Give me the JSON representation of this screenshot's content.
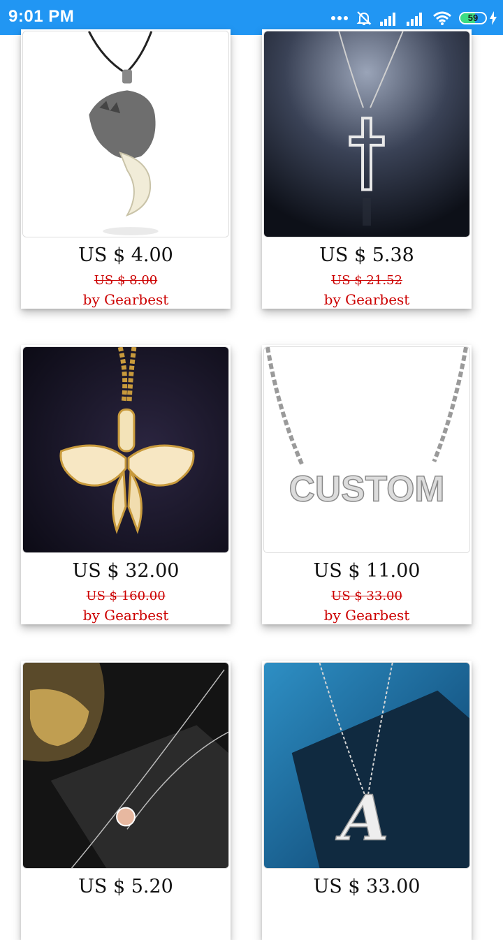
{
  "status_bar": {
    "time": "9:01 PM",
    "battery_level": "59"
  },
  "products": [
    {
      "name": "wolf-tooth-pendant",
      "price": "US $ 4.00",
      "old_price": "US $ 8.00",
      "seller": "by Gearbest"
    },
    {
      "name": "cross-pendant",
      "price": "US $ 5.38",
      "old_price": "US $ 21.52",
      "seller": "by Gearbest"
    },
    {
      "name": "butterfly-pendant",
      "price": "US $ 32.00",
      "old_price": "US $ 160.00",
      "seller": "by Gearbest"
    },
    {
      "name": "custom-name-necklace",
      "price": "US $ 11.00",
      "old_price": "US $ 33.00",
      "seller": "by Gearbest",
      "image_text": "CUSTOM"
    },
    {
      "name": "crystal-pendant",
      "price": "US $ 5.20",
      "old_price": "",
      "seller": ""
    },
    {
      "name": "letter-a-necklace",
      "price": "US $ 33.00",
      "old_price": "",
      "seller": "",
      "image_text": "A"
    }
  ]
}
